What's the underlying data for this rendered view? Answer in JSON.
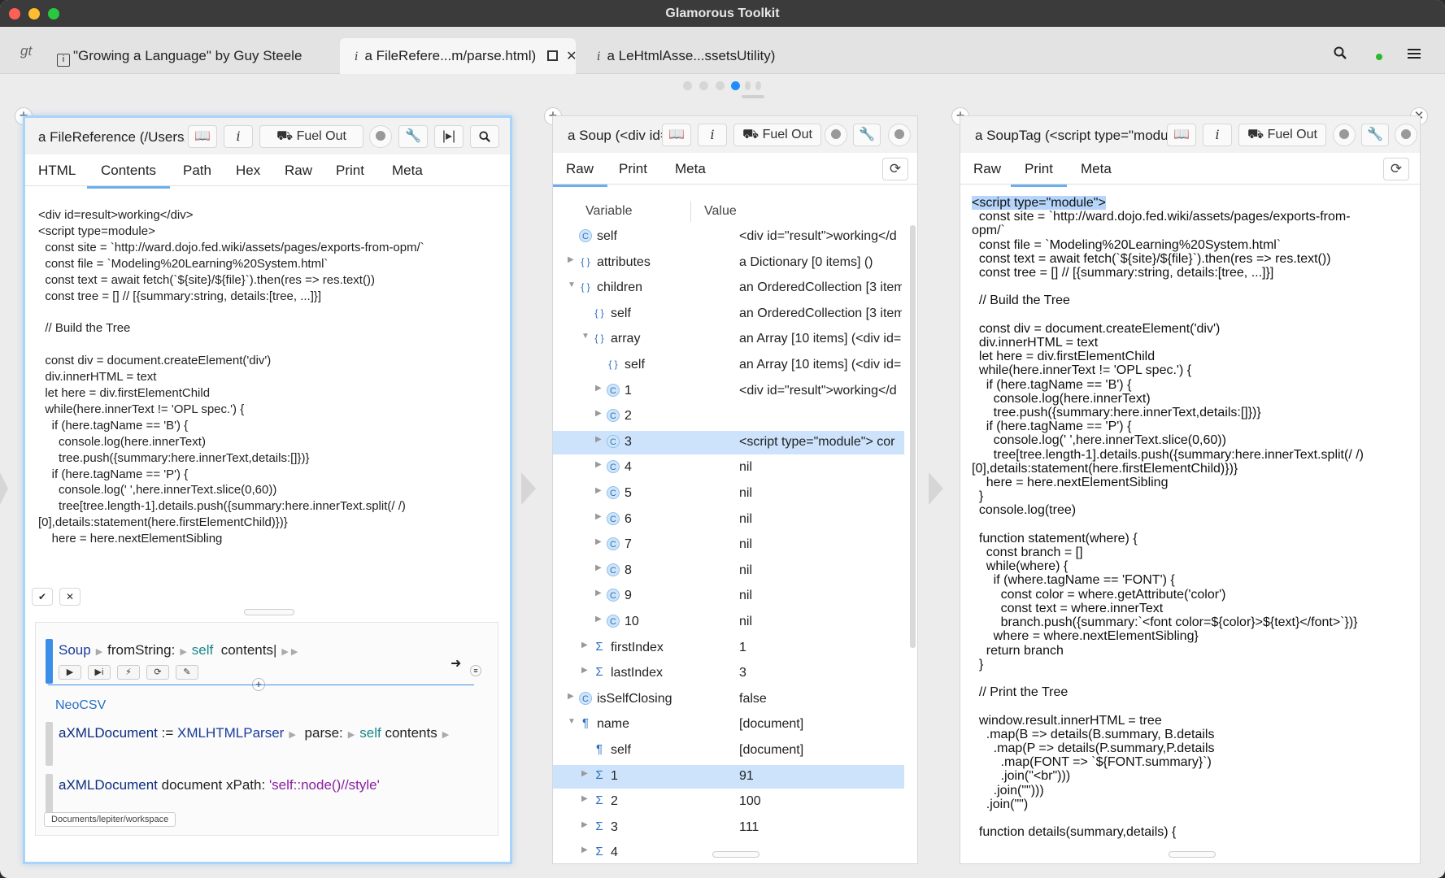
{
  "window": {
    "title": "Glamorous Toolkit"
  },
  "tabs": [
    {
      "label": "\"Growing a Language\" by Guy Steele",
      "icon": "page-icon"
    },
    {
      "label": "a FileRefere...m/parse.html)",
      "icon": "inspector-icon",
      "active": true
    },
    {
      "label": "a LeHtmlAsse...ssetsUtility)",
      "icon": "inspector-icon"
    }
  ],
  "logo": "gt",
  "pane1": {
    "title": "a FileReference (/Users/",
    "fuel_out": "Fuel Out",
    "tabs": [
      "HTML",
      "Contents",
      "Path",
      "Hex",
      "Raw",
      "Print",
      "Meta"
    ],
    "active_tab": "Contents",
    "code": "<div id=result>working</div>\n<script type=module>\n  const site = `http://ward.dojo.fed.wiki/assets/pages/exports-from-opm/`\n  const file = `Modeling%20Learning%20System.html`\n  const text = await fetch(`${site}/${file}`).then(res => res.text())\n  const tree = [] // [{summary:string, details:[tree, ...]}]\n\n  // Build the Tree\n\n  const div = document.createElement('div')\n  div.innerHTML = text\n  let here = div.firstElementChild\n  while(here.innerText != 'OPL spec.') {\n    if (here.tagName == 'B') {\n      console.log(here.innerText)\n      tree.push({summary:here.innerText,details:[]})}\n    if (here.tagName == 'P') {\n      console.log(' ',here.innerText.slice(0,60))\n      tree[tree.length-1].details.push({summary:here.innerText.split(/ /)\n[0],details:statement(here.firstElementChild)})}\n    here = here.nextElementSibling",
    "snippet1": {
      "cls": "Soup",
      "sel1": "fromString:",
      "self": "self",
      "msg": "contents"
    },
    "snippet2": "NeoCSV",
    "snippet3": {
      "var": "aXMLDocument",
      "assign": ":=",
      "cls": "XMLHTMLParser",
      "sel": "parse:",
      "self": "self",
      "msg": "contents"
    },
    "snippet4": {
      "var": "aXMLDocument",
      "rest": "document xPath:",
      "str": "'self::node()//style'"
    },
    "path_chip": "Documents/lepiter/workspace"
  },
  "pane2": {
    "title": "a Soup (<div id=",
    "fuel_out": "Fuel Out",
    "tabs": [
      "Raw",
      "Print",
      "Meta"
    ],
    "active_tab": "Raw",
    "col_variable": "Variable",
    "col_value": "Value",
    "rows": [
      {
        "indent": 0,
        "exp": "",
        "icon": "c",
        "name": "self",
        "value": "<div id=\"result\">working</d"
      },
      {
        "indent": 0,
        "exp": "▶",
        "icon": "brace",
        "name": "attributes",
        "value": "a Dictionary [0 items] ()"
      },
      {
        "indent": 0,
        "exp": "▼",
        "icon": "brace",
        "name": "children",
        "value": "an OrderedCollection [3 item"
      },
      {
        "indent": 1,
        "exp": "",
        "icon": "brace",
        "name": "self",
        "value": "an OrderedCollection [3 item"
      },
      {
        "indent": 1,
        "exp": "▼",
        "icon": "brace",
        "name": "array",
        "value": "an Array [10 items] (<div id='"
      },
      {
        "indent": 2,
        "exp": "",
        "icon": "brace",
        "name": "self",
        "value": "an Array [10 items] (<div id='"
      },
      {
        "indent": 2,
        "exp": "▶",
        "icon": "c",
        "name": "1",
        "value": "<div id=\"result\">working</d"
      },
      {
        "indent": 2,
        "exp": "▶",
        "icon": "c",
        "name": "2",
        "value": ""
      },
      {
        "indent": 2,
        "exp": "▶",
        "icon": "c",
        "name": "3",
        "value": "<script type=\"module\">   cor",
        "selected": true
      },
      {
        "indent": 2,
        "exp": "▶",
        "icon": "c",
        "name": "4",
        "value": "nil"
      },
      {
        "indent": 2,
        "exp": "▶",
        "icon": "c",
        "name": "5",
        "value": "nil"
      },
      {
        "indent": 2,
        "exp": "▶",
        "icon": "c",
        "name": "6",
        "value": "nil"
      },
      {
        "indent": 2,
        "exp": "▶",
        "icon": "c",
        "name": "7",
        "value": "nil"
      },
      {
        "indent": 2,
        "exp": "▶",
        "icon": "c",
        "name": "8",
        "value": "nil"
      },
      {
        "indent": 2,
        "exp": "▶",
        "icon": "c",
        "name": "9",
        "value": "nil"
      },
      {
        "indent": 2,
        "exp": "▶",
        "icon": "c",
        "name": "10",
        "value": "nil"
      },
      {
        "indent": 1,
        "exp": "▶",
        "icon": "sigma",
        "name": "firstIndex",
        "value": "1"
      },
      {
        "indent": 1,
        "exp": "▶",
        "icon": "sigma",
        "name": "lastIndex",
        "value": "3"
      },
      {
        "indent": 0,
        "exp": "▶",
        "icon": "c",
        "name": "isSelfClosing",
        "value": "false"
      },
      {
        "indent": 0,
        "exp": "▼",
        "icon": "pilcrow",
        "name": "name",
        "value": "[document]"
      },
      {
        "indent": 1,
        "exp": "",
        "icon": "pilcrow",
        "name": "self",
        "value": "[document]"
      },
      {
        "indent": 1,
        "exp": "▶",
        "icon": "sigma",
        "name": "1",
        "value": "91",
        "selected": true
      },
      {
        "indent": 1,
        "exp": "▶",
        "icon": "sigma",
        "name": "2",
        "value": "100"
      },
      {
        "indent": 1,
        "exp": "▶",
        "icon": "sigma",
        "name": "3",
        "value": "111"
      },
      {
        "indent": 1,
        "exp": "▶",
        "icon": "sigma",
        "name": "4",
        "value": ""
      }
    ]
  },
  "pane3": {
    "title": "a SoupTag (<script type=\"modu",
    "fuel_out": "Fuel Out",
    "tabs": [
      "Raw",
      "Print",
      "Meta"
    ],
    "active_tab": "Print",
    "highlight": "<script type=\"module\">",
    "code": "\n  const site = `http://ward.dojo.fed.wiki/assets/pages/exports-from-\nopm/`\n  const file = `Modeling%20Learning%20System.html`\n  const text = await fetch(`${site}/${file}`).then(res => res.text())\n  const tree = [] // [{summary:string, details:[tree, ...]}]\n\n  // Build the Tree\n\n  const div = document.createElement('div')\n  div.innerHTML = text\n  let here = div.firstElementChild\n  while(here.innerText != 'OPL spec.') {\n    if (here.tagName == 'B') {\n      console.log(here.innerText)\n      tree.push({summary:here.innerText,details:[]})}\n    if (here.tagName == 'P') {\n      console.log(' ',here.innerText.slice(0,60))\n      tree[tree.length-1].details.push({summary:here.innerText.split(/ /)\n[0],details:statement(here.firstElementChild)})}\n    here = here.nextElementSibling\n  }\n  console.log(tree)\n\n  function statement(where) {\n    const branch = []\n    while(where) {\n      if (where.tagName == 'FONT') {\n        const color = where.getAttribute('color')\n        const text = where.innerText\n        branch.push({summary:`<font color=${color}>${text}</font>`})}\n      where = where.nextElementSibling}\n    return branch\n  }\n\n  // Print the Tree\n\n  window.result.innerHTML = tree\n    .map(B => details(B.summary, B.details\n      .map(P => details(P.summary,P.details\n        .map(FONT => `${FONT.summary}`)\n        .join(\"<br\")))\n      .join(\"\")))\n    .join(\"\")\n\n  function details(summary,details) {"
  }
}
